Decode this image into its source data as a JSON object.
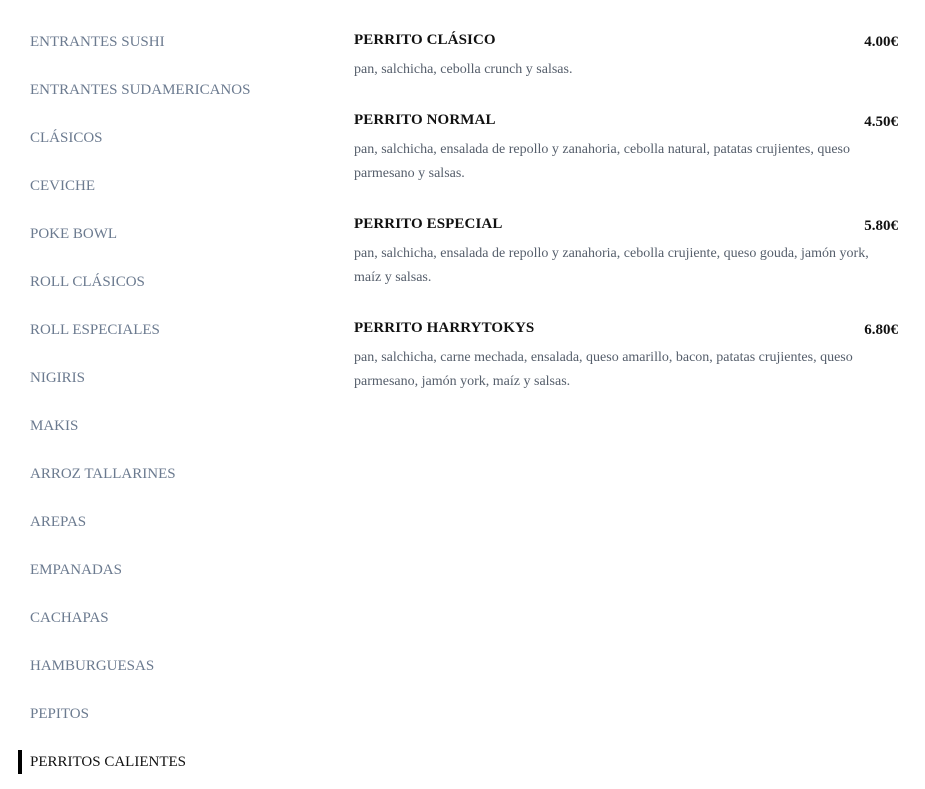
{
  "sidebar": {
    "items": [
      {
        "label": "ENTRANTES SUSHI"
      },
      {
        "label": "ENTRANTES SUDAMERICANOS"
      },
      {
        "label": "CLÁSICOS"
      },
      {
        "label": "CEVICHE"
      },
      {
        "label": "POKE BOWL"
      },
      {
        "label": "ROLL CLÁSICOS"
      },
      {
        "label": "ROLL ESPECIALES"
      },
      {
        "label": "NIGIRIS"
      },
      {
        "label": "MAKIS"
      },
      {
        "label": "ARROZ TALLARINES"
      },
      {
        "label": "AREPAS"
      },
      {
        "label": "EMPANADAS"
      },
      {
        "label": "CACHAPAS"
      },
      {
        "label": "HAMBURGUESAS"
      },
      {
        "label": "PEPITOS"
      },
      {
        "label": "PERRITOS CALIENTES"
      }
    ],
    "active_index": 15
  },
  "products": [
    {
      "name": "PERRITO CLÁSICO",
      "price": "4.00€",
      "description": "pan, salchicha, cebolla crunch y salsas."
    },
    {
      "name": "PERRITO NORMAL",
      "price": "4.50€",
      "description": "pan, salchicha, ensalada de repollo y zanahoria, cebolla natural, patatas crujientes, queso parmesano y salsas."
    },
    {
      "name": "PERRITO ESPECIAL",
      "price": "5.80€",
      "description": "pan, salchicha, ensalada de repollo y zanahoria, cebolla crujiente, queso gouda, jamón york, maíz y salsas."
    },
    {
      "name": "PERRITO HARRYTOKYS",
      "price": "6.80€",
      "description": "pan, salchicha, carne mechada, ensalada, queso amarillo, bacon, patatas crujientes, queso parmesano, jamón york, maíz y salsas."
    }
  ]
}
